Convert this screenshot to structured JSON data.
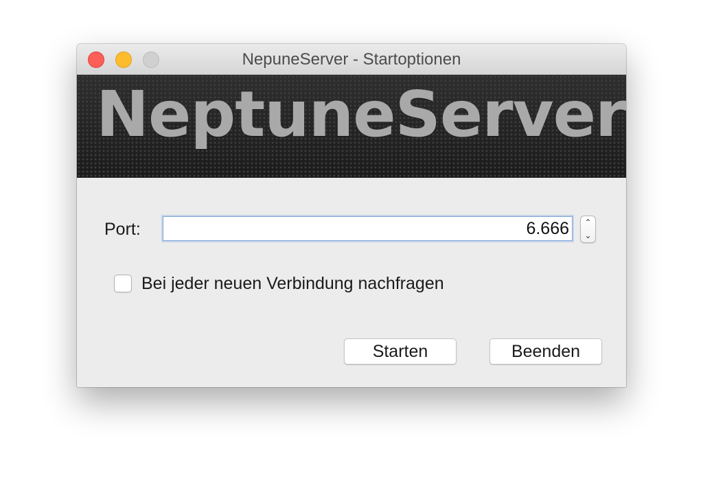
{
  "window": {
    "title": "NepuneServer - Startoptionen",
    "traffic_lights": {
      "close_color": "#fc5f57",
      "minimize_color": "#fdbc2e",
      "zoom_color": "#d0d0d0"
    }
  },
  "banner": {
    "logo_text": "NeptuneServer",
    "background_color": "#262626",
    "text_color": "#a9a9a9"
  },
  "form": {
    "port_label": "Port:",
    "port_value": "6.666",
    "stepper": {
      "up_icon": "chevron-up-icon",
      "down_icon": "chevron-down-icon",
      "up_glyph": "⌃",
      "down_glyph": "⌄"
    },
    "ask_checkbox": {
      "label": "Bei jeder neuen Verbindung nachfragen",
      "checked": false
    }
  },
  "actions": {
    "start_label": "Starten",
    "quit_label": "Beenden"
  }
}
